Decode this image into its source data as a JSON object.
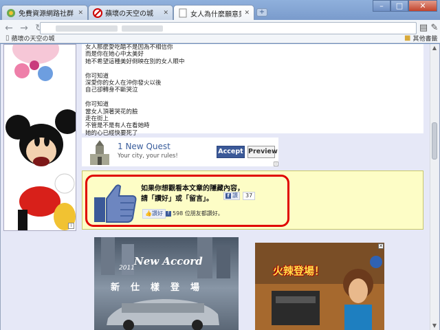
{
  "browser": {
    "tabs": [
      {
        "label": "免費資源網路社群 -- 免...",
        "active": false
      },
      {
        "label": "蘋壞の天空の城",
        "active": false
      },
      {
        "label": "女人為什麼願意男人撫著...",
        "active": true
      }
    ],
    "new_tab_symbol": "+",
    "window_buttons": {
      "minimize": "–",
      "maximize": "□",
      "close": "✕"
    }
  },
  "toolbar": {
    "back": "←",
    "forward": "→",
    "reload": "↻",
    "page_menu": "▤",
    "wrench": "✎"
  },
  "bookmarks": {
    "items": [
      {
        "label": "蘋壞の天空の城"
      }
    ],
    "other": "其他書籤"
  },
  "article": {
    "lines": [
      "女人那麼愛吃醋不是因為不相信你",
      "而是你在她心中太美好",
      "她不希望這種美好倒映在別的女人眼中",
      "",
      "你可知道",
      "深愛你的女人在沖你發火以後",
      "自己卻轉身不斷哭泣",
      "",
      "你可知道",
      "當女人頂著哭花的臉",
      "走在街上",
      "不管是不是有人在看她時",
      "她的心已經快要死了"
    ]
  },
  "quest_ad": {
    "title": "1 New Quest",
    "subtitle": "Your city, your rules!",
    "accept": "Accept",
    "preview": "Preview"
  },
  "like_prompt": {
    "line1": "如果你想觀看本文章的隱藏內容，",
    "line2": "請「讚好」或「留言」。",
    "share_label": "讚",
    "share_count": "37",
    "like_label": "讚好",
    "like_count_text": "598 位朋友都讚好。"
  },
  "accord_ad": {
    "year": "2011",
    "model": "New Accord",
    "slogan": "新仕樣登場"
  },
  "game_ad": {
    "title": "火辣登場！"
  },
  "colors": {
    "accent": "#3b5998",
    "highlight_border": "#e00000",
    "notice_background": "#fdfdc6"
  }
}
